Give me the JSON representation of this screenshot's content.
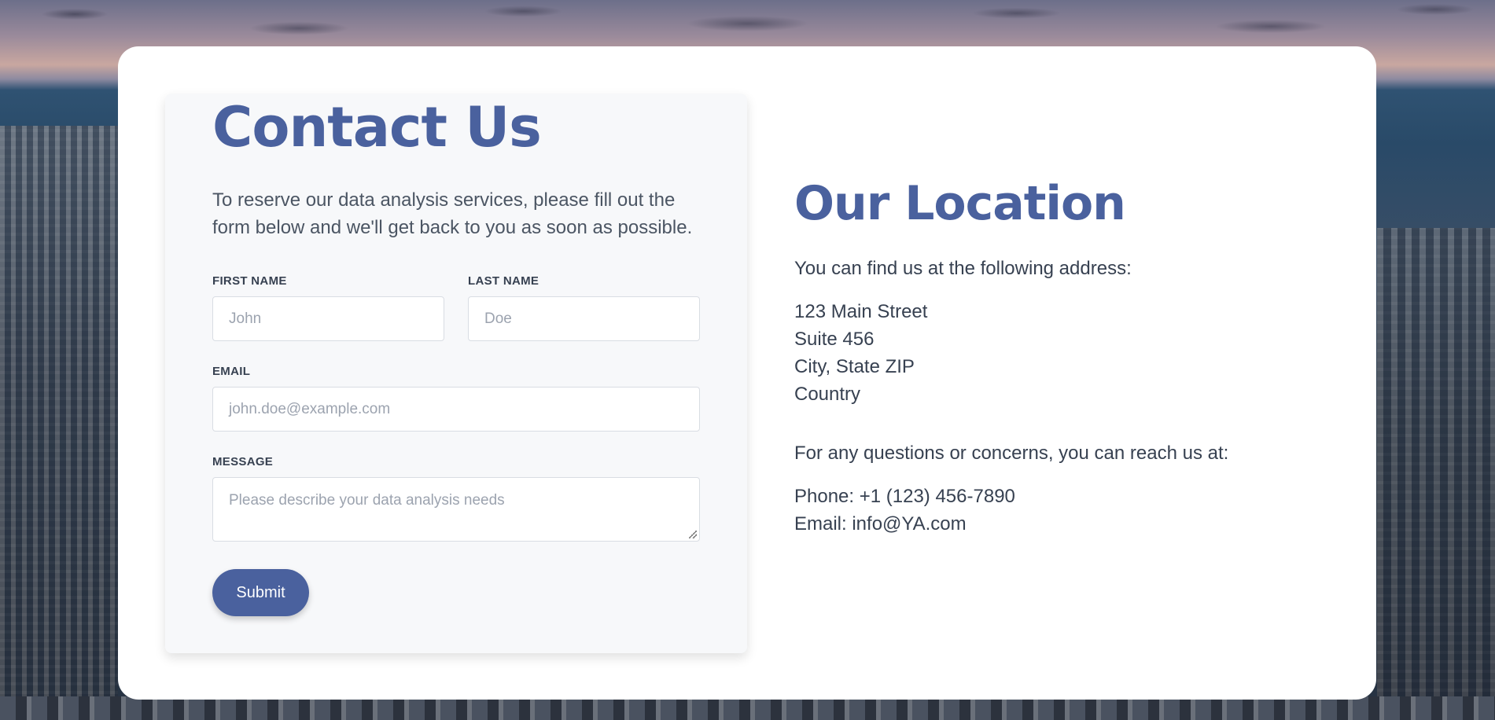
{
  "contact": {
    "title": "Contact Us",
    "intro": "To reserve our data analysis services, please fill out the form below and we'll get back to you as soon as possible.",
    "first_name": {
      "label": "FIRST NAME",
      "placeholder": "John"
    },
    "last_name": {
      "label": "LAST NAME",
      "placeholder": "Doe"
    },
    "email": {
      "label": "EMAIL",
      "placeholder": "john.doe@example.com"
    },
    "message": {
      "label": "MESSAGE",
      "placeholder": "Please describe your data analysis needs"
    },
    "submit_label": "Submit",
    "accent_color": "#4a619e"
  },
  "location": {
    "title": "Our Location",
    "address_intro": "You can find us at the following address:",
    "address_lines": [
      "123 Main Street",
      "Suite 456",
      "City, State ZIP",
      "Country"
    ],
    "contact_intro": "For any questions or concerns, you can reach us at:",
    "phone": "Phone: +1 (123) 456-7890",
    "email": "Email: info@YA.com"
  }
}
